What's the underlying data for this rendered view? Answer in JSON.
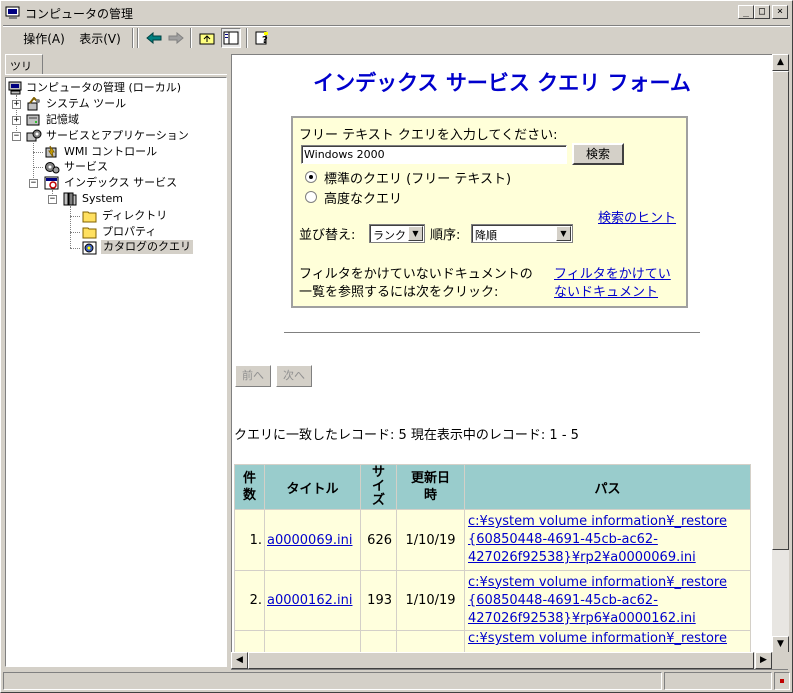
{
  "window": {
    "title": "コンピュータの管理",
    "min": "_",
    "max": "□",
    "close": "×"
  },
  "menu": {
    "action": "操作(A)",
    "view": "表示(V)"
  },
  "tree_tab": "ツリー",
  "tree": {
    "root": "コンピュータの管理 (ローカル)",
    "system_tools": "システム ツール",
    "storage": "記憶域",
    "services_apps": "サービスとアプリケーション",
    "wmi": "WMI コントロール",
    "services": "サービス",
    "indexing": "インデックス サービス",
    "system": "System",
    "directory": "ディレクトリ",
    "properties": "プロパティ",
    "catalog_query": "カタログのクエリ"
  },
  "form": {
    "heading": "インデックス サービス クエリ フォーム",
    "prompt": "フリー テキスト クエリを入力してください:",
    "query_value": "Windows 2000",
    "search_button": "検索",
    "radio_standard": "標準のクエリ (フリー テキスト)",
    "radio_advanced": "高度なクエリ",
    "search_hints": "検索のヒント",
    "sort_label": "並び替え:",
    "sort_value": "ランク",
    "order_label": "順序:",
    "order_value": "降順",
    "unfiltered_text_1": "フィルタをかけていないドキュメントの",
    "unfiltered_text_2": "一覧を参照するには次をクリック:",
    "unfiltered_link_1": "フィルタをかけてい",
    "unfiltered_link_2": "ないドキュメント"
  },
  "nav": {
    "prev": "前へ",
    "next": "次へ"
  },
  "summary": "クエリに一致したレコード: 5 現在表示中のレコード: 1 - 5",
  "results": {
    "headers": {
      "count_1": "件",
      "count_2": "数",
      "title": "タイトル",
      "size_1": "サ",
      "size_2": "イ",
      "size_3": "ズ",
      "updated_1": "更新日",
      "updated_2": "時",
      "path": "パス"
    },
    "rows": [
      {
        "num": "1.",
        "title": "a0000069.ini",
        "size": "626",
        "date": "1/10/19",
        "path_1": "c:¥system volume information¥_restore",
        "path_2": "{60850448-4691-45cb-ac62-",
        "path_3": "427026f92538}¥rp2¥a0000069.ini"
      },
      {
        "num": "2.",
        "title": "a0000162.ini",
        "size": "193",
        "date": "1/10/19",
        "path_1": "c:¥system volume information¥_restore",
        "path_2": "{60850448-4691-45cb-ac62-",
        "path_3": "427026f92538}¥rp6¥a0000162.ini"
      },
      {
        "num": "",
        "title": "",
        "size": "",
        "date": "",
        "path_1": "c:¥system volume information¥_restore",
        "path_2": "",
        "path_3": ""
      }
    ]
  },
  "colors": {
    "heading": "#0000cc",
    "form_bg": "#ffffd9",
    "table_header": "#99cccc",
    "table_body": "#ffffdd"
  }
}
